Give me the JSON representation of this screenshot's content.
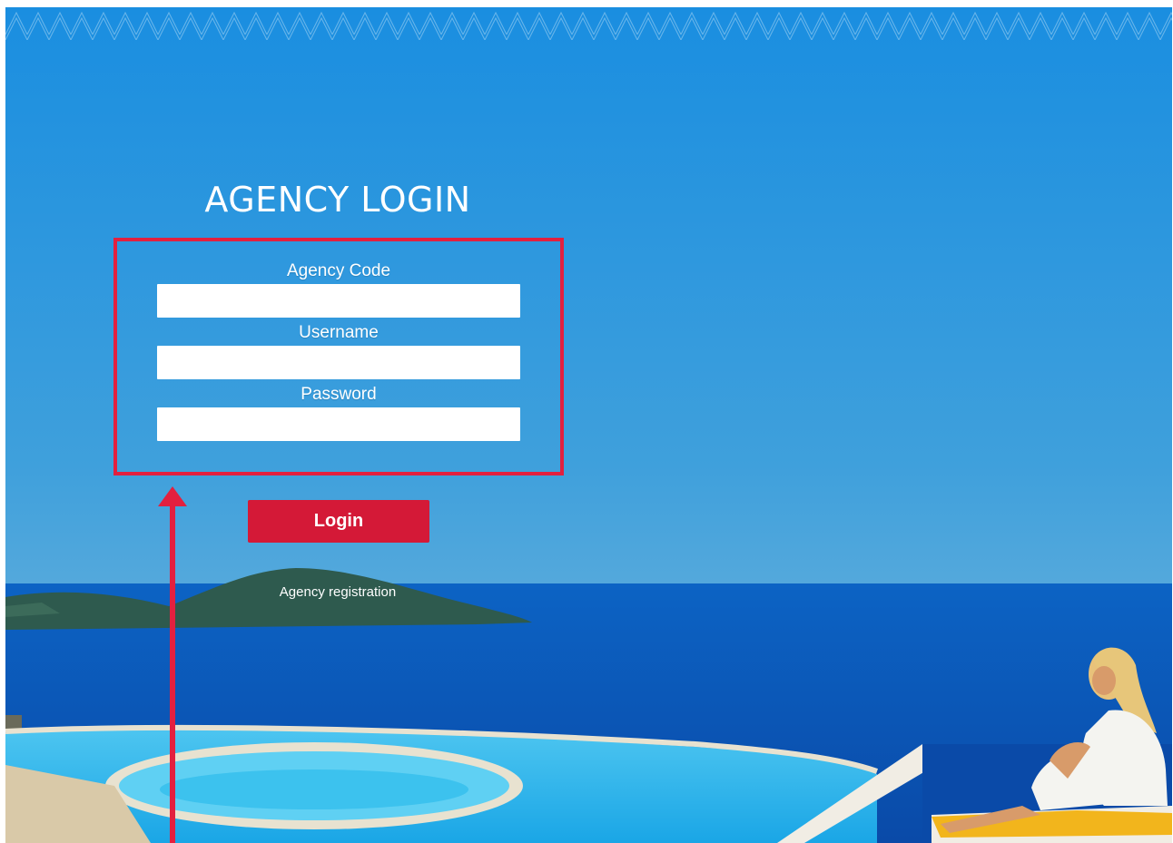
{
  "page": {
    "title": "AGENCY LOGIN"
  },
  "form": {
    "agency_code_label": "Agency Code",
    "agency_code_value": "",
    "username_label": "Username",
    "username_value": "",
    "password_label": "Password",
    "password_value": ""
  },
  "actions": {
    "login_label": "Login",
    "registration_label": "Agency registration"
  },
  "colors": {
    "accent": "#d41937",
    "annotation": "#e3203f",
    "sky": "#1e8fd8",
    "sea": "#0a58b8",
    "pool": "#35b9ec"
  },
  "annotation": {
    "highlight": "form-fields-highlight",
    "arrow": "up-arrow-icon"
  }
}
